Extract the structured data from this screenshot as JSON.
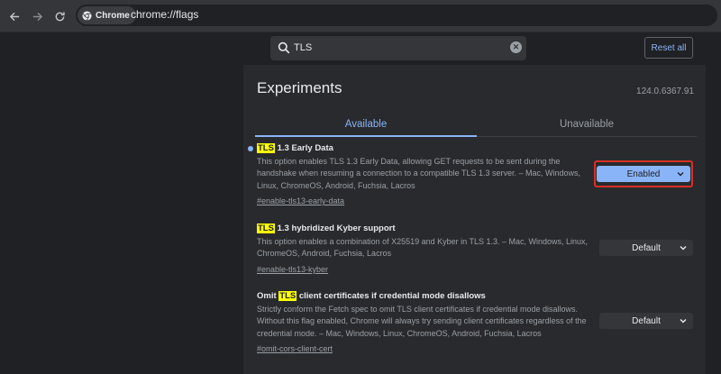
{
  "browser": {
    "site_chip": "Chrome",
    "url": "chrome://flags"
  },
  "search": {
    "value": "TLS",
    "placeholder": "Search flags"
  },
  "header": {
    "reset_label": "Reset all"
  },
  "main": {
    "title": "Experiments",
    "version": "124.0.6367.91",
    "tabs": [
      {
        "label": "Available",
        "active": true
      },
      {
        "label": "Unavailable",
        "active": false
      }
    ]
  },
  "experiments": [
    {
      "title_pre": "",
      "title_hl": "TLS",
      "title_post": " 1.3 Early Data",
      "description": "This option enables TLS 1.3 Early Data, allowing GET requests to be sent during the handshake when resuming a connection to a compatible TLS 1.3 server. – Mac, Windows, Linux, ChromeOS, Android, Fuchsia, Lacros",
      "link": "#enable-tls13-early-data",
      "select_value": "Enabled",
      "modified": true
    },
    {
      "title_pre": "",
      "title_hl": "TLS",
      "title_post": " 1.3 hybridized Kyber support",
      "description": "This option enables a combination of X25519 and Kyber in TLS 1.3. – Mac, Windows, Linux, ChromeOS, Android, Fuchsia, Lacros",
      "link": "#enable-tls13-kyber",
      "select_value": "Default",
      "modified": false
    },
    {
      "title_pre": "Omit ",
      "title_hl": "TLS",
      "title_post": " client certificates if credential mode disallows",
      "description": "Strictly conform the Fetch spec to omit TLS client certificates if credential mode disallows. Without this flag enabled, Chrome will always try sending client certificates regardless of the credential mode. – Mac, Windows, Linux, ChromeOS, Android, Fuchsia, Lacros",
      "link": "#omit-cors-client-cert",
      "select_value": "Default",
      "modified": false
    }
  ],
  "colors": {
    "accent": "#8ab4f8",
    "highlight": "#ffff00",
    "focus_ring": "#d93025",
    "background": "#202124",
    "panel": "#292a2d"
  },
  "icons": {
    "back": "arrow-left-icon",
    "forward": "arrow-right-icon",
    "reload": "reload-icon",
    "site": "chrome-logo-icon",
    "search": "search-icon",
    "clear": "clear-icon",
    "dropdown": "chevron-down-icon"
  }
}
